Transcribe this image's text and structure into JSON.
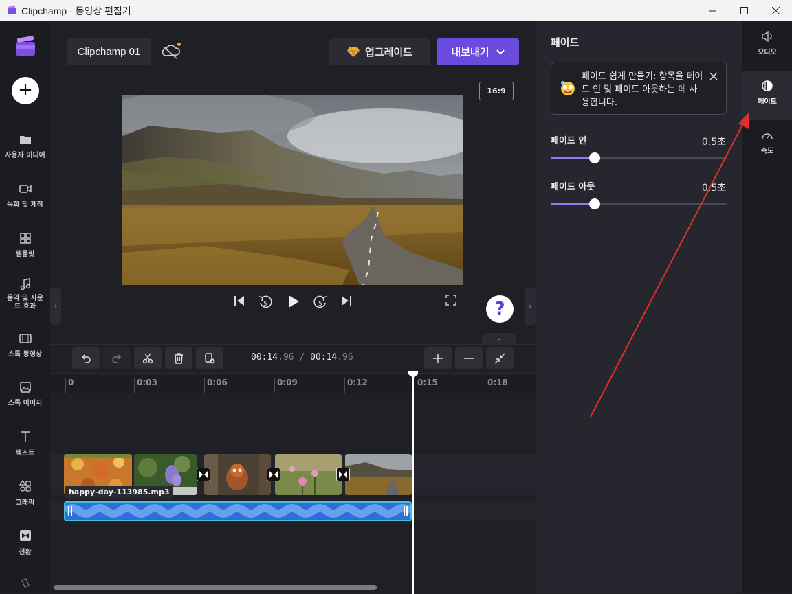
{
  "window": {
    "title": "Clipchamp - 동영상 편집기",
    "minimize": "—",
    "maximize": "☐",
    "close": "✕"
  },
  "sidebar": {
    "items": [
      {
        "label": "사용자 미디어",
        "icon": "folder-icon"
      },
      {
        "label": "녹화 및 제작",
        "icon": "video-camera-icon"
      },
      {
        "label": "템플릿",
        "icon": "templates-icon"
      },
      {
        "label": "음악 및 사운드 효과",
        "icon": "music-note-icon"
      },
      {
        "label": "스톡 동영상",
        "icon": "film-icon"
      },
      {
        "label": "스톡 이미지",
        "icon": "image-icon"
      },
      {
        "label": "텍스트",
        "icon": "text-icon"
      },
      {
        "label": "그래픽",
        "icon": "shapes-icon"
      },
      {
        "label": "전환",
        "icon": "transition-icon"
      }
    ]
  },
  "header": {
    "project_name": "Clipchamp 01",
    "upgrade_label": "업그레이드",
    "export_label": "내보내기",
    "aspect_ratio": "16:9"
  },
  "timeline": {
    "current_time_main": "00:14",
    "current_time_frac": ".96",
    "separator": " / ",
    "total_time_main": "00:14",
    "total_time_frac": ".96",
    "ticks": [
      "0",
      "0:03",
      "0:06",
      "0:09",
      "0:12",
      "0:15",
      "0:18"
    ],
    "audio_clip_name": "happy-day-113985.mp3"
  },
  "panel": {
    "title": "페이드",
    "tip_text": "페이드 쉽게 만들기: 항목을 페이드 인 및 페이드 아웃하는 데 사용합니다.",
    "fade_in_label": "페이드 인",
    "fade_in_value": "0.5초",
    "fade_in_level": 0.25,
    "fade_out_label": "페이드 아웃",
    "fade_out_value": "0.5초",
    "fade_out_level": 0.25
  },
  "right_tabs": [
    {
      "label": "오디오",
      "icon": "speaker-icon"
    },
    {
      "label": "페이드",
      "icon": "fade-icon"
    },
    {
      "label": "속도",
      "icon": "speedometer-icon"
    }
  ],
  "colors": {
    "accent": "#6a4bde",
    "annotation_arrow": "#e0302c",
    "audio_clip": "#2d6fd6"
  }
}
